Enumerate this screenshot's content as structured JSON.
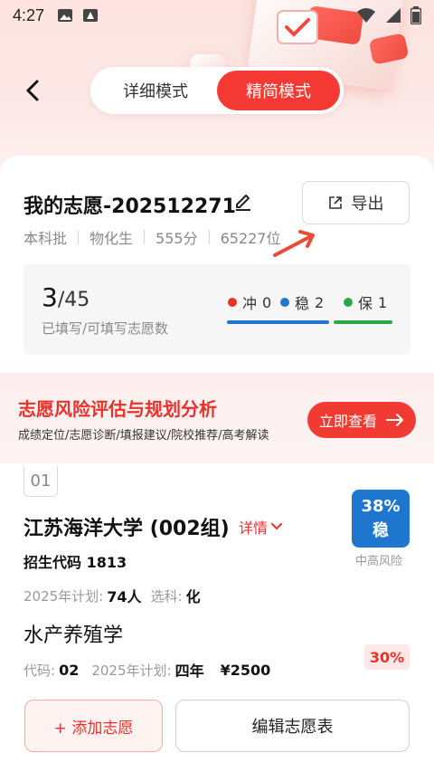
{
  "status_bar": {
    "time": "4:27",
    "icons": [
      "gallery-icon",
      "app-icon",
      "wifi-icon",
      "signal-icon",
      "battery-icon"
    ]
  },
  "nav": {
    "modes": [
      "详细模式",
      "精简模式"
    ],
    "active_mode": "精简模式"
  },
  "profile": {
    "title": "我的志愿-202512271",
    "export_label": "导出",
    "meta": [
      "本科批",
      "物化生",
      "555分",
      "65227位"
    ]
  },
  "stats": {
    "filled": "3",
    "total": "/45",
    "hint": "已填写/可填写志愿数",
    "legend": [
      {
        "label": "冲",
        "count": "0",
        "color": "#e8322a"
      },
      {
        "label": "稳",
        "count": "2",
        "color": "#1f76cf"
      },
      {
        "label": "保",
        "count": "1",
        "color": "#2aa84a"
      }
    ]
  },
  "banner": {
    "title": "志愿风险评估与规划分析",
    "subtitle": "成绩定位/志愿诊断/填报建议/院校推荐/高考解读",
    "button": "立即查看"
  },
  "entry": {
    "index": "01",
    "university": "江苏海洋大学 (002组)",
    "detail_label": "详情",
    "code_label": "招生代码",
    "code_value": "1813",
    "probability": "38%",
    "level": "稳",
    "risk": "中高风险",
    "plan_label": "2025年计划:",
    "plan_value": "74人",
    "subject_label": "选科:",
    "subject_value": "化",
    "major": {
      "name": "水产养殖学",
      "probability": "30%",
      "code_label": "代码:",
      "code_value": "02",
      "plan_label": "2025年计划:",
      "plan_value": "四年",
      "fee": "¥2500"
    }
  },
  "actions": {
    "add": "+ 添加志愿",
    "edit": "编辑志愿表"
  }
}
